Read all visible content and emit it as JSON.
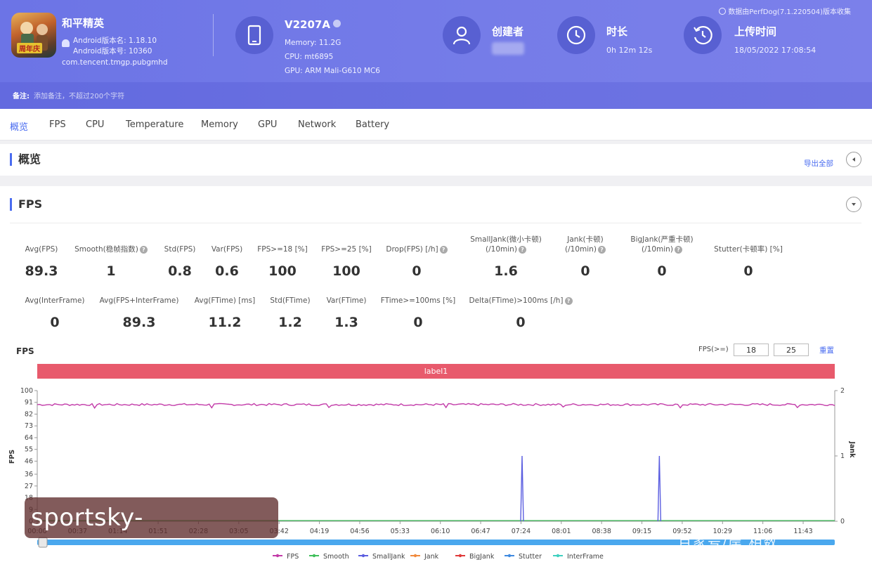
{
  "app": {
    "name": "和平精英",
    "version_name": "Android版本名: 1.18.10",
    "version_code": "Android版本号: 10360",
    "package": "com.tencent.tmgp.pubgmhd",
    "icon_text": "周年庆"
  },
  "device": {
    "model": "V2207A",
    "memory": "Memory: 11.2G",
    "cpu": "CPU: mt6895",
    "gpu": "GPU: ARM Mali-G610 MC6"
  },
  "creator": {
    "label": "创建者"
  },
  "duration": {
    "label": "时长",
    "value": "0h 12m 12s"
  },
  "upload": {
    "label": "上传时间",
    "value": "18/05/2022 17:08:54"
  },
  "collect_info": "数据由PerfDog(7.1.220504)版本收集",
  "notes": {
    "label": "备注:",
    "placeholder": "添加备注，不超过200个字符"
  },
  "tabs": [
    "概览",
    "FPS",
    "CPU",
    "Temperature",
    "Memory",
    "GPU",
    "Network",
    "Battery"
  ],
  "overview": {
    "title": "概览",
    "export_label": "导出全部"
  },
  "fps_section": {
    "title": "FPS"
  },
  "metrics_row1": [
    {
      "label": "Avg(FPS)",
      "value": "89.3"
    },
    {
      "label": "Smooth(稳帧指数)",
      "value": "1"
    },
    {
      "label": "Std(FPS)",
      "value": "0.8"
    },
    {
      "label": "Var(FPS)",
      "value": "0.6"
    },
    {
      "label": "FPS>=18 [%]",
      "value": "100"
    },
    {
      "label": "FPS>=25 [%]",
      "value": "100"
    },
    {
      "label": "Drop(FPS) [/h]",
      "value": "0"
    },
    {
      "label": "SmallJank(微小卡顿)",
      "label2": "(/10min)",
      "value": "1.6"
    },
    {
      "label": "Jank(卡顿)",
      "label2": "(/10min)",
      "value": "0"
    },
    {
      "label": "BigJank(严重卡顿)",
      "label2": "(/10min)",
      "value": "0"
    },
    {
      "label": "Stutter(卡顿率) [%]",
      "value": "0"
    }
  ],
  "metrics_row2": [
    {
      "label": "Avg(InterFrame)",
      "value": "0"
    },
    {
      "label": "Avg(FPS+InterFrame)",
      "value": "89.3"
    },
    {
      "label": "Avg(FTime) [ms]",
      "value": "11.2"
    },
    {
      "label": "Std(FTime)",
      "value": "1.2"
    },
    {
      "label": "Var(FTime)",
      "value": "1.3"
    },
    {
      "label": "FTime>=100ms [%]",
      "value": "0"
    },
    {
      "label": "Delta(FTime)>100ms [/h]",
      "value": "0"
    }
  ],
  "chart_controls": {
    "title": "FPS",
    "threshold_label": "FPS(>=)",
    "threshold1": "18",
    "threshold2": "25",
    "reset": "重置"
  },
  "label_band": "label1",
  "watermark": "sportsky-yaxing.com",
  "watermark2": "百家号/岸   相数",
  "colors": {
    "header": "#6c74e6",
    "accent": "#4a6cf0",
    "fps": "#c23aa8",
    "smooth": "#3fbf5a",
    "smalljank": "#5b5ee0",
    "jank": "#f08a3c",
    "bigjank": "#e03a3a",
    "stutter": "#3f8ae0",
    "interframe": "#3fd0c0",
    "band": "#e85a6c"
  },
  "chart_data": {
    "type": "line",
    "title": "FPS",
    "xlabel": "",
    "ylabel": "FPS",
    "y2label": "Jank",
    "ylim": [
      0,
      100
    ],
    "y2lim": [
      0,
      2
    ],
    "y_ticks": [
      "100",
      "91",
      "82",
      "73",
      "64",
      "55",
      "46",
      "36",
      "27",
      "18",
      "9",
      "0"
    ],
    "y2_ticks": [
      "2",
      "1",
      "0"
    ],
    "x_ticks": [
      "00:00",
      "00:37",
      "01:14",
      "01:51",
      "02:28",
      "03:05",
      "03:42",
      "04:19",
      "04:56",
      "05:33",
      "06:10",
      "06:47",
      "07:24",
      "08:01",
      "08:38",
      "09:15",
      "09:52",
      "10:29",
      "11:06",
      "11:43"
    ],
    "duration_s": 732,
    "series": [
      {
        "name": "FPS",
        "axis": "left",
        "mean": 89.3,
        "min": 86.5,
        "max": 90.5
      },
      {
        "name": "Smooth",
        "axis": "left",
        "values": []
      },
      {
        "name": "SmallJank",
        "axis": "right",
        "events": [
          {
            "t": 445,
            "value": 1
          },
          {
            "t": 571,
            "value": 1
          }
        ]
      },
      {
        "name": "Jank",
        "axis": "right",
        "values": []
      },
      {
        "name": "BigJank",
        "axis": "right",
        "values": []
      },
      {
        "name": "Stutter",
        "axis": "right",
        "values": []
      },
      {
        "name": "InterFrame",
        "axis": "left",
        "values": []
      }
    ],
    "legend": [
      "FPS",
      "Smooth",
      "SmallJank",
      "Jank",
      "BigJank",
      "Stutter",
      "InterFrame"
    ],
    "legend_position": "bottom",
    "grid": false
  }
}
